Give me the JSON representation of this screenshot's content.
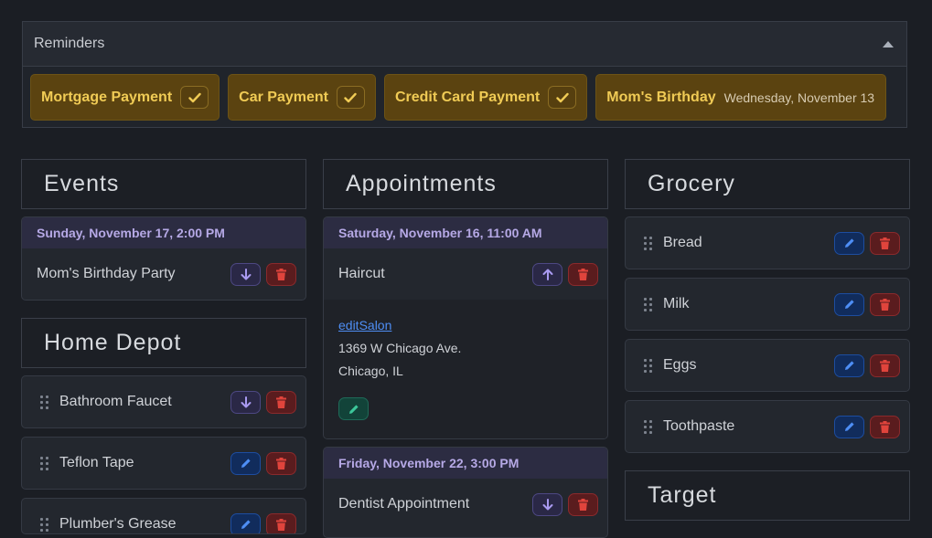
{
  "reminders": {
    "title": "Reminders",
    "items": [
      {
        "label": "Mortgage Payment",
        "type": "check"
      },
      {
        "label": "Car Payment",
        "type": "check"
      },
      {
        "label": "Credit Card Payment",
        "type": "check"
      },
      {
        "label": "Mom's Birthday",
        "date": "Wednesday, November 13",
        "type": "date"
      }
    ]
  },
  "events": {
    "title": "Events",
    "items": [
      {
        "date": "Sunday, November 17, 2:00 PM",
        "label": "Mom's Birthday Party"
      }
    ]
  },
  "home_depot": {
    "title": "Home Depot",
    "items": [
      "Bathroom Faucet",
      "Teflon Tape",
      "Plumber's Grease"
    ]
  },
  "appointments": {
    "title": "Appointments",
    "items": [
      {
        "date": "Saturday, November 16, 11:00 AM",
        "label": "Haircut",
        "link": "editSalon",
        "address1": "1369 W Chicago Ave.",
        "address2": "Chicago, IL"
      },
      {
        "date": "Friday, November 22, 3:00 PM",
        "label": "Dentist Appointment"
      }
    ]
  },
  "grocery": {
    "title": "Grocery",
    "items": [
      "Bread",
      "Milk",
      "Eggs",
      "Toothpaste"
    ]
  },
  "target": {
    "title": "Target"
  },
  "colors": {
    "accent_gold": "#f0cb55",
    "date_purple": "#b6a9e6",
    "edit_blue": "#4e8ef5",
    "delete_red": "#e0443c",
    "link_blue": "#4e8ef5"
  }
}
